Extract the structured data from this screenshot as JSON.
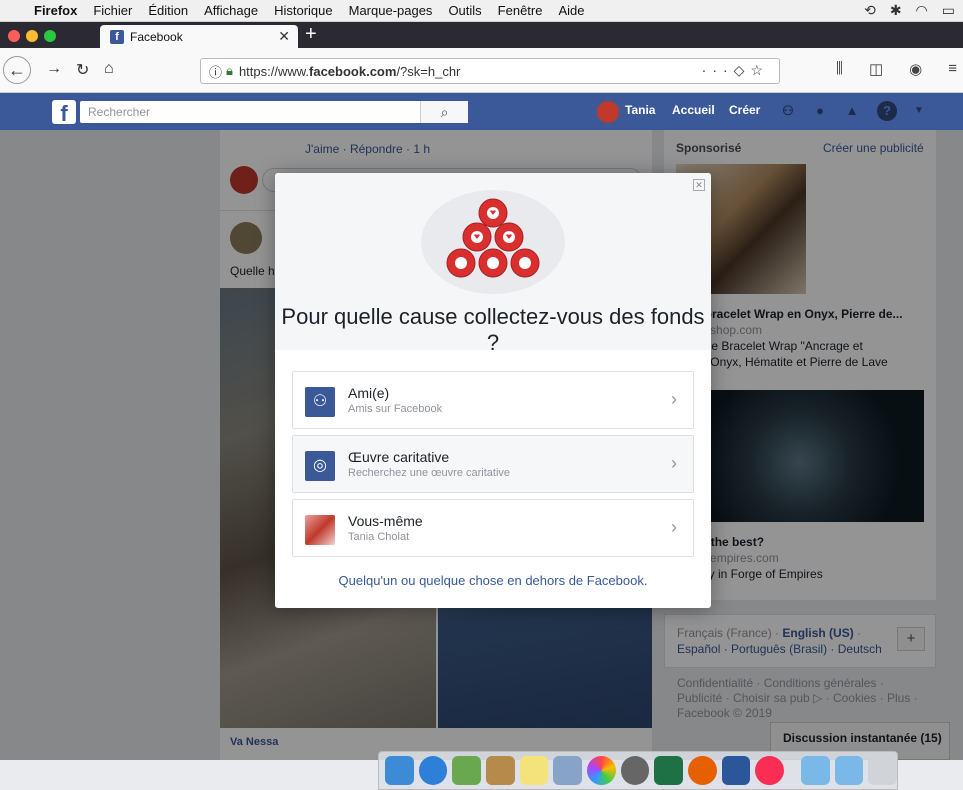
{
  "menubar": {
    "app": "Firefox",
    "items": [
      "Fichier",
      "Édition",
      "Affichage",
      "Historique",
      "Marque-pages",
      "Outils",
      "Fenêtre",
      "Aide"
    ]
  },
  "browser": {
    "tab_title": "Facebook",
    "url_prefix": "https://www.",
    "url_domain": "facebook.com",
    "url_path": "/?sk=h_chr"
  },
  "fb_header": {
    "search_placeholder": "Rechercher",
    "user_name": "Tania",
    "nav_home": "Accueil",
    "nav_create": "Créer"
  },
  "feed": {
    "comment_actions": "J'aime · Répondre · 1 h",
    "post_text_partial": "Quelle h",
    "bottom_author": "Va Nessa"
  },
  "sidebar": {
    "sponsored": "Sponsorisé",
    "create_ad": "Créer une publicité",
    "ad1_title": "erbe bracelet Wrap en Onyx, Pierre de...",
    "ad1_domain": "-yoga-shop.com",
    "ad1_desc_l1": "gnifique Bracelet Wrap \"Ancrage et",
    "ad1_desc_l2": "té\" en Onyx, Hématite et Pierre de Lave",
    "ad1_desc_l3": "...",
    "ad2_title": "era is the best?",
    "ad2_domain": "orgeofempires.com",
    "ad2_desc": "our city in Forge of Empires",
    "lang_l1_a": "Français (France) · ",
    "lang_l1_b": "English (US)",
    "lang_l1_c": " ·",
    "lang_l2": "Español · Português (Brasil) · Deutsch",
    "lang_plus": "+",
    "footer_l1": "Confidentialité · Conditions générales ·",
    "footer_l2": "Publicité · Choisir sa pub ▷ · Cookies · Plus ·",
    "footer_l3": "Facebook © 2019"
  },
  "chat": {
    "label": "Discussion instantanée (15)"
  },
  "modal": {
    "title": "Pour quelle cause collectez-vous des fonds ?",
    "options": [
      {
        "title": "Ami(e)",
        "subtitle": "Amis sur Facebook",
        "icon": "friends-icon"
      },
      {
        "title": "Œuvre caritative",
        "subtitle": "Recherchez une œuvre caritative",
        "icon": "globe-icon"
      },
      {
        "title": "Vous-même",
        "subtitle": "Tania Cholat",
        "icon": "profile-photo"
      }
    ],
    "footer_link": "Quelqu'un ou quelque chose en dehors de Facebook."
  },
  "colors": {
    "fb_blue": "#3b5998",
    "link_blue": "#385898",
    "overlay": "#000000"
  }
}
